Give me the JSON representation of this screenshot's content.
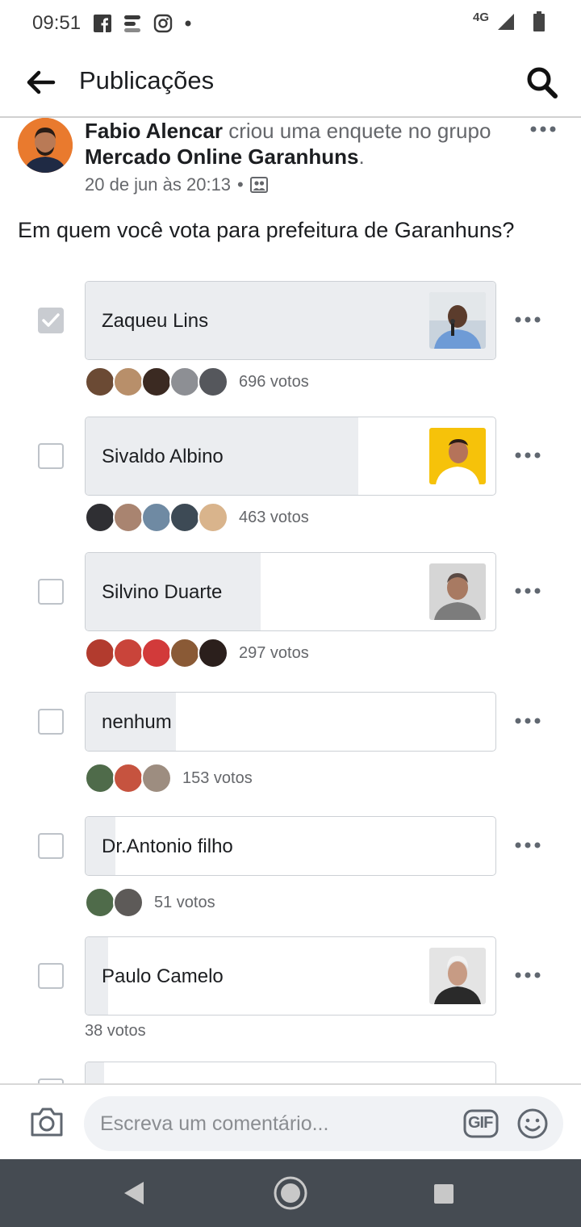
{
  "status_bar": {
    "time": "09:51",
    "network": "4G",
    "icons": [
      "facebook-icon",
      "app-icon",
      "instagram-icon",
      "dot-icon",
      "signal-icon",
      "battery-icon"
    ]
  },
  "header": {
    "title": "Publicações",
    "icons": [
      "back-arrow-icon",
      "search-icon"
    ]
  },
  "post": {
    "author": "Fabio Alencar",
    "action": " criou uma enquete no grupo ",
    "group": "Mercado Online Garanhuns",
    "group_suffix": ".",
    "date": "20 de jun às 20:13",
    "separator": "•",
    "question": "Em quem você vota para prefeitura de Garanhuns?"
  },
  "poll": {
    "options": [
      {
        "label": "Zaqueu Lins",
        "votes": 696,
        "votes_text": "696 votos",
        "checked": true,
        "fill_fraction": 1.0,
        "has_photo": true
      },
      {
        "label": "Sivaldo Albino",
        "votes": 463,
        "votes_text": "463 votos",
        "checked": false,
        "fill_fraction": 0.665,
        "has_photo": true
      },
      {
        "label": "Silvino Duarte",
        "votes": 297,
        "votes_text": "297 votos",
        "checked": false,
        "fill_fraction": 0.427,
        "has_photo": true
      },
      {
        "label": "nenhum",
        "votes": 153,
        "votes_text": "153 votos",
        "checked": false,
        "fill_fraction": 0.22,
        "has_photo": false
      },
      {
        "label": "Dr.Antonio filho",
        "votes": 51,
        "votes_text": "51 votos",
        "checked": false,
        "fill_fraction": 0.073,
        "has_photo": false
      },
      {
        "label": "Paulo Camelo",
        "votes": 38,
        "votes_text": "38 votos",
        "checked": false,
        "fill_fraction": 0.055,
        "has_photo": true
      }
    ]
  },
  "comment": {
    "placeholder": "Escreva um comentário...",
    "gif_label": "GIF"
  },
  "colors": {
    "text_primary": "#1c1e21",
    "text_secondary": "#65676b",
    "poll_fill": "#ebedf0",
    "nav_bar": "#454b52"
  }
}
